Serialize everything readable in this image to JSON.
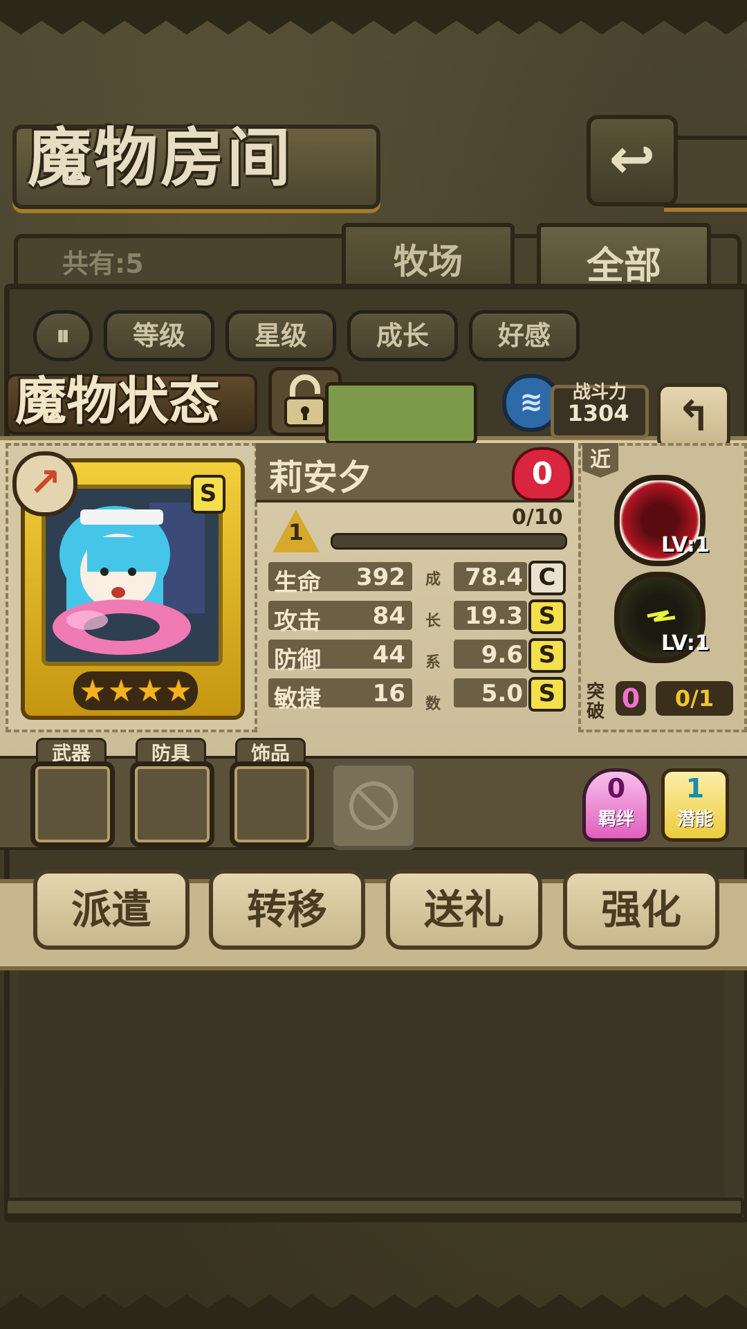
{
  "header": {
    "title": "魔物房间"
  },
  "tabs": {
    "count_label": "共有:5",
    "ranch": "牧场",
    "all": "全部"
  },
  "sort": {
    "toggle": "⏸",
    "level": "等级",
    "star": "星级",
    "growth": "成长",
    "affection": "好感"
  },
  "status": {
    "title": "魔物状态",
    "power_label": "战斗力",
    "power_value": "1304",
    "rank_badge": "S",
    "monster_name": "莉安夕",
    "hearts": "0",
    "level": "1",
    "exp": "0/10",
    "stars": 4,
    "growth_label": "成长系数",
    "stats": [
      {
        "label": "生命",
        "value": "392",
        "growth": "78.4",
        "grade": "C"
      },
      {
        "label": "攻击",
        "value": "84",
        "growth": "19.3",
        "grade": "S"
      },
      {
        "label": "防御",
        "value": "44",
        "growth": "9.6",
        "grade": "S"
      },
      {
        "label": "敏捷",
        "value": "16",
        "growth": "5.0",
        "grade": "S"
      }
    ],
    "range_tag": "近",
    "skills": [
      {
        "icon": "bite-skill-icon",
        "level": "LV:1"
      },
      {
        "icon": "lightning-skill-icon",
        "level": "LV:1"
      }
    ],
    "breakthrough_label": "突破",
    "breakthrough_count": "0",
    "breakthrough_progress": "0/1"
  },
  "equipment": {
    "weapon": "武器",
    "armor": "防具",
    "accessory": "饰品",
    "bond_count": "0",
    "bond_label": "羁绊",
    "potential_count": "1",
    "potential_label": "潜能"
  },
  "actions": {
    "dispatch": "派遣",
    "transfer": "转移",
    "gift": "送礼",
    "enhance": "强化"
  },
  "colors": {
    "gold_frame": "#f2cf3a",
    "heart_red": "#d9253d",
    "grade_yellow": "#f3e04a",
    "bond_pink": "#e87ac8",
    "parchment": "#d9ccaa"
  }
}
